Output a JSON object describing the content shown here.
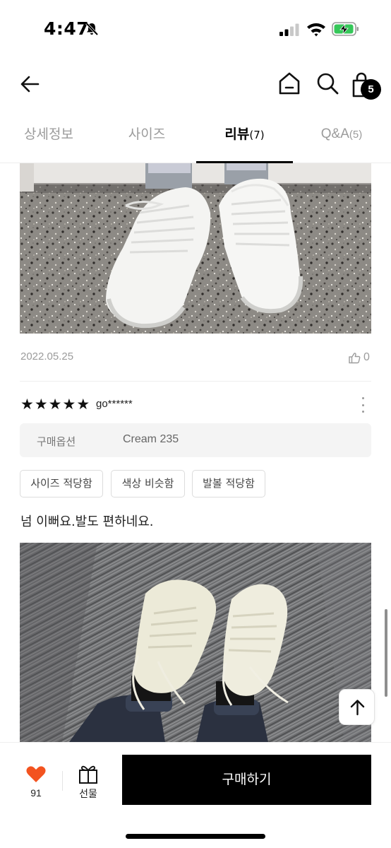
{
  "status_bar": {
    "time": "4:47"
  },
  "header": {
    "icons": [
      "back-arrow-icon",
      "home-icon",
      "search-icon",
      "shopping-bag-icon"
    ],
    "cart_count": "5"
  },
  "tabs": [
    {
      "label": "상세정보",
      "count": ""
    },
    {
      "label": "사이즈",
      "count": ""
    },
    {
      "label": "리뷰",
      "count": "(7)"
    },
    {
      "label": "Q&A",
      "count": "(5)"
    }
  ],
  "previous_review": {
    "date": "2022.05.25",
    "likes": "0"
  },
  "review": {
    "rating": 5,
    "stars": "★★★★★",
    "reviewer": "go******",
    "option_label": "구매옵션",
    "option_value": "Cream 235",
    "tags": [
      "사이즈 적당함",
      "색상 비슷함",
      "발볼 적당함"
    ],
    "text": "넘 이뻐요.발도 편하네요."
  },
  "bottom_bar": {
    "wish_count": "91",
    "gift_label": "선물",
    "buy_label": "구매하기"
  },
  "colors": {
    "accent_heart": "#f3531f",
    "primary_button": "#000000",
    "muted_text": "#9b9b9b"
  }
}
